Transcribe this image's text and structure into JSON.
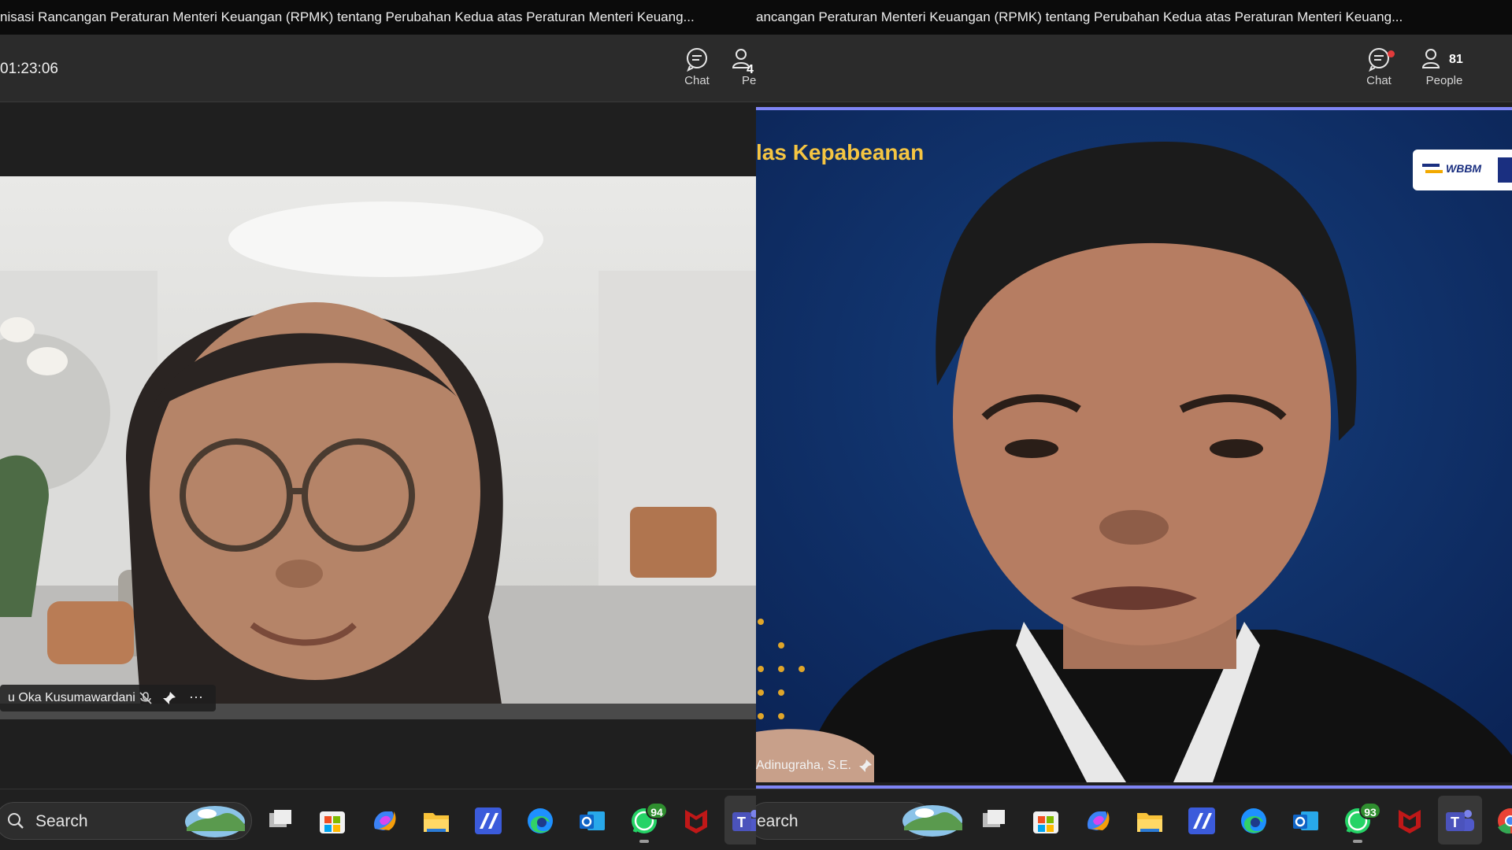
{
  "left": {
    "title": "nisasi Rancangan Peraturan Menteri Keuangan (RPMK) tentang Perubahan Kedua atas Peraturan Menteri Keuang...",
    "timer": "01:23:06",
    "chat_label": "Chat",
    "people_label": "Pe",
    "people_count": "4",
    "participant_name": "u Oka Kusumawardani",
    "more_label": "···",
    "search_text": "Search",
    "whatsapp_badge": "94"
  },
  "right": {
    "title": "ancangan Peraturan Menteri Keuangan (RPMK) tentang Perubahan Kedua atas Peraturan Menteri Keuang...",
    "chat_label": "Chat",
    "people_label": "People",
    "people_count": "81",
    "banner_text": "las Kepabeanan",
    "logo_text": "WBBM",
    "participant_name": "Adinugraha, S.E.",
    "search_text": "earch",
    "whatsapp_badge": "93"
  },
  "colors": {
    "accent": "#7f85f5",
    "banner_text": "#f5c542",
    "stage_blue": "#0e2a63",
    "notification_dot": "#e23b3b",
    "badge_green": "#2f8f2f"
  },
  "icons": {
    "taskbar": [
      "search-icon",
      "landscape-widget",
      "task-view-icon",
      "store-icon",
      "copilot-icon",
      "file-explorer-icon",
      "maple-app-icon",
      "edge-icon",
      "outlook-icon",
      "whatsapp-icon",
      "mcafee-icon",
      "teams-icon",
      "chrome-icon"
    ]
  }
}
